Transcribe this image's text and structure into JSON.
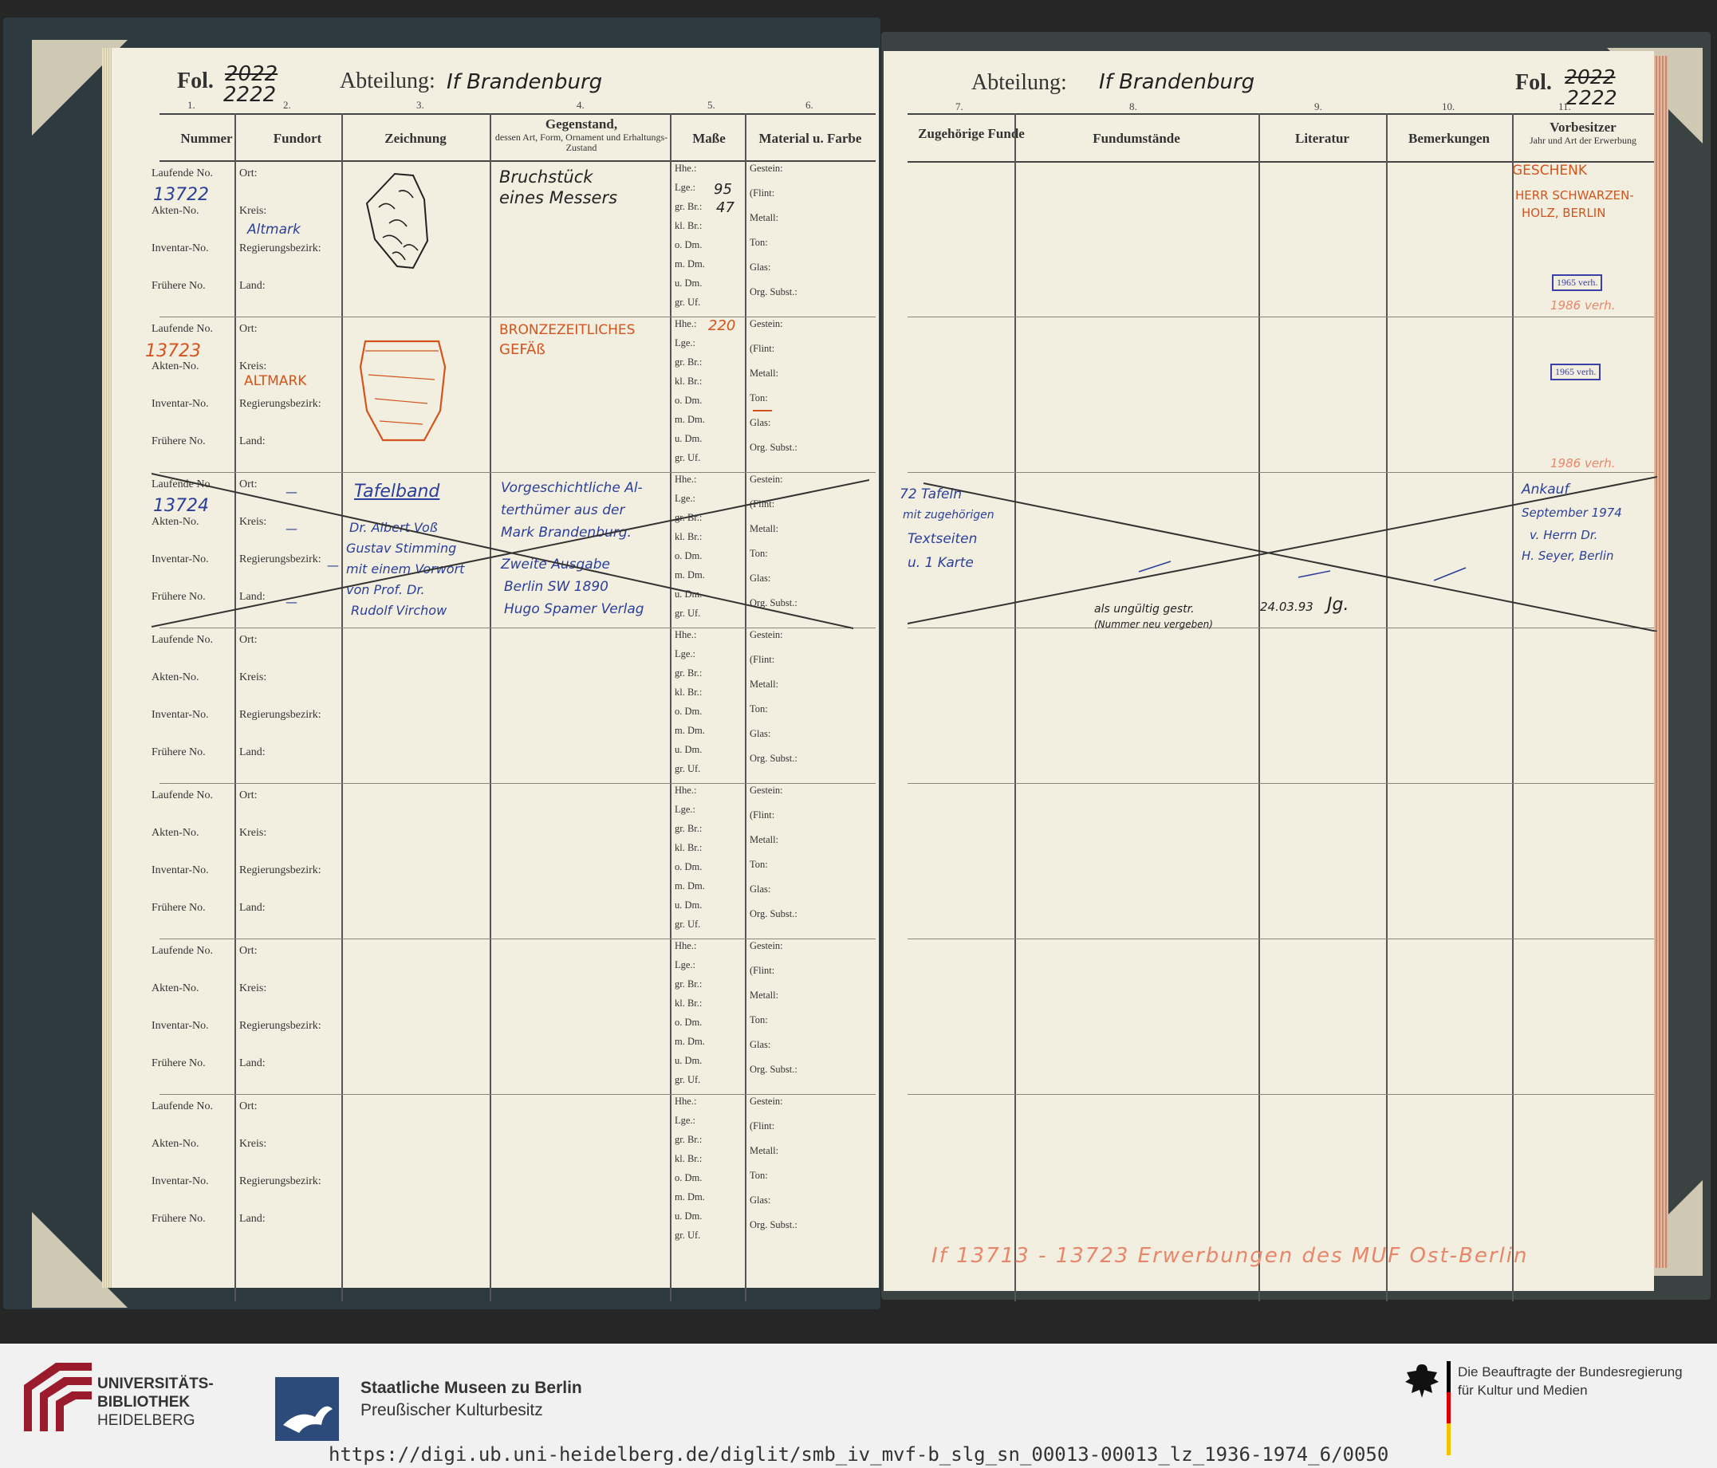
{
  "left_page": {
    "fol_label": "Fol.",
    "fol_old": "2022",
    "fol_new": "2222",
    "abteilung_label": "Abteilung:",
    "abteilung_value": "If   Brandenburg",
    "col_numbers": [
      "1.",
      "2.",
      "3.",
      "4.",
      "5.",
      "6."
    ],
    "headers": {
      "nummer": "Nummer",
      "fundort": "Fundort",
      "zeichnung": "Zeichnung",
      "gegenstand": "Gegenstand,",
      "gegenstand_sub": "dessen Art, Form, Ornament und Erhaltungs-Zustand",
      "masse": "Maße",
      "material": "Material u. Farbe"
    },
    "row_labels": {
      "laufende": "Laufende No.",
      "akten": "Akten-No.",
      "inventar": "Inventar-No.",
      "fruehere": "Frühere No.",
      "ort": "Ort:",
      "kreis": "Kreis:",
      "regierung": "Regierungsbezirk:",
      "land": "Land:",
      "measures": [
        "Hhe.:",
        "Lge.:",
        "gr. Br.:",
        "kl. Br.:",
        "o. Dm.",
        "m. Dm.",
        "u. Dm.",
        "gr. Uf."
      ],
      "materials": [
        "Gestein:",
        "(Flint:",
        "Metall:",
        "Ton:",
        "Glas:",
        "Org. Subst.:"
      ]
    }
  },
  "entries": {
    "e1": {
      "laufende": "13722",
      "kreis": "Altmark",
      "gegenstand_1": "Bruchstück",
      "gegenstand_2": "eines Messers",
      "lge": "95",
      "gr_br": "47"
    },
    "e2": {
      "laufende": "13723",
      "kreis": "ALTMARK",
      "gegenstand_1": "BRONZEZEITLICHES",
      "gegenstand_2": "GEFÄß",
      "hhe": "220"
    },
    "e3": {
      "laufende": "13724",
      "ort": "—",
      "kreis": "—",
      "regierung": "—",
      "land": "—",
      "zeichnung": [
        "Tafelband",
        "Dr. Albert Voß",
        "Gustav Stimming",
        "mit einem Vorwort",
        "von Prof. Dr.",
        "Rudolf Virchow"
      ],
      "gegenstand": [
        "Vorgeschichtliche Al-",
        "terthümer aus der",
        "Mark Brandenburg.",
        "Zweite Ausgabe",
        "Berlin SW 1890",
        "Hugo Spamer Verlag"
      ],
      "zugehoerige": [
        "72 Tafeln",
        "mit zugehörigen",
        "Textseiten",
        "u. 1 Karte"
      ],
      "note_1": "als ungültig gestr.",
      "note_2": "(Nummer neu vergeben)",
      "date": "24.03.93",
      "initials": "Jg.",
      "vorbesitzer": [
        "Ankauf",
        "September 1974",
        "v. Herrn Dr.",
        "H. Seyer, Berlin"
      ]
    }
  },
  "right_page": {
    "abteilung_label": "Abteilung:",
    "abteilung_value": "If   Brandenburg",
    "fol_label": "Fol.",
    "fol_old": "2022",
    "fol_new": "2222",
    "col_numbers": [
      "7.",
      "8.",
      "9.",
      "10.",
      "11."
    ],
    "headers": {
      "zugehoerige": "Zugehörige Funde",
      "fundumstaende": "Fundumstände",
      "literatur": "Literatur",
      "bemerkungen": "Bemerkungen",
      "vorbesitzer": "Vorbesitzer",
      "vorbesitzer_sub": "Jahr und Art der Erwerbung"
    },
    "vorbesitzer_e1": [
      "GESCHENK",
      "HERR SCHWARZEN-",
      "HOLZ, BERLIN"
    ],
    "stamp_1": "1965 verh.",
    "note_1986a": "1986 verh.",
    "stamp_2": "1965 verh.",
    "note_1986b": "1986 verh.",
    "bottom_note": "If  13713 - 13723  Erwerbungen des MUF Ost-Berlin"
  },
  "footer": {
    "ub_line1": "UNIVERSITÄTS-",
    "ub_line2": "BIBLIOTHEK",
    "ub_line3": "HEIDELBERG",
    "smb_line1": "Staatliche Museen zu Berlin",
    "smb_line2": "Preußischer Kulturbesitz",
    "bkm_line1": "Die Beauftragte der Bundesregierung",
    "bkm_line2": "für Kultur und Medien",
    "url": "https://digi.ub.uni-heidelberg.de/diglit/smb_iv_mvf-b_slg_sn_00013-00013_lz_1936-1974_6/0050"
  }
}
